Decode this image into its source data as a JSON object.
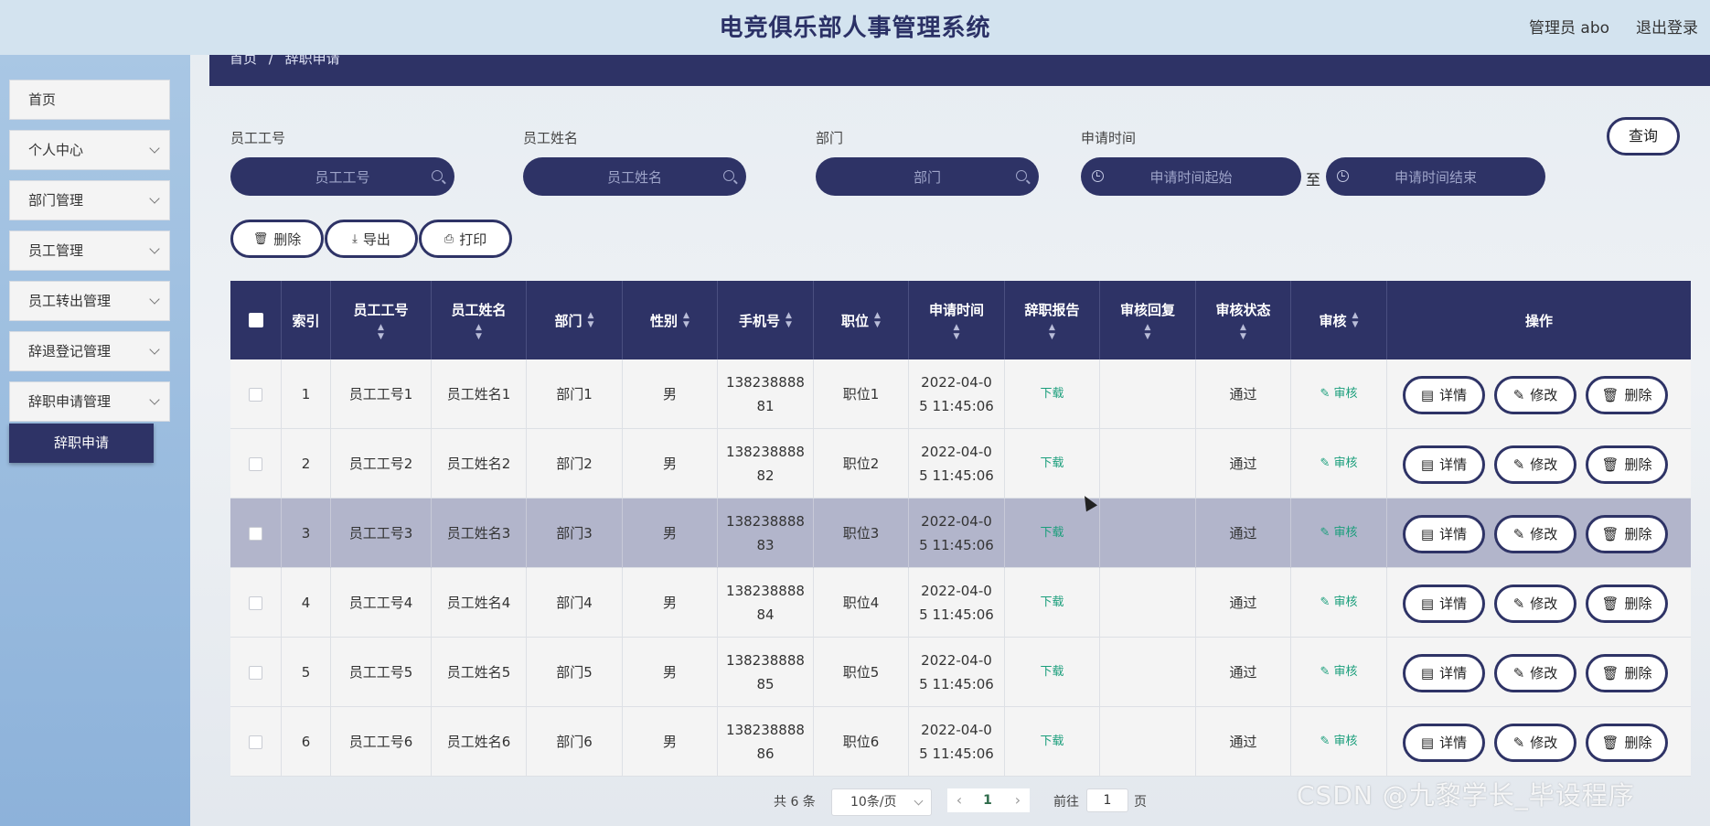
{
  "header": {
    "title": "电竞俱乐部人事管理系统",
    "admin": "管理员 abo",
    "logout": "退出登录"
  },
  "sidebar": {
    "items": [
      {
        "label": "首页",
        "expandable": false
      },
      {
        "label": "个人中心",
        "expandable": true
      },
      {
        "label": "部门管理",
        "expandable": true
      },
      {
        "label": "员工管理",
        "expandable": true
      },
      {
        "label": "员工转出管理",
        "expandable": true
      },
      {
        "label": "辞退登记管理",
        "expandable": true
      },
      {
        "label": "辞职申请管理",
        "expandable": true
      }
    ],
    "active_sub": "辞职申请"
  },
  "breadcrumb": {
    "home": "首页",
    "sep": "/",
    "current": "辞职申请"
  },
  "search": {
    "emp_no_label": "员工工号",
    "emp_no_placeholder": "员工工号",
    "emp_name_label": "员工姓名",
    "emp_name_placeholder": "员工姓名",
    "dept_label": "部门",
    "dept_placeholder": "部门",
    "time_label": "申请时间",
    "time_start_placeholder": "申请时间起始",
    "time_to": "至",
    "time_end_placeholder": "申请时间结束",
    "query_button": "查询"
  },
  "actions": {
    "delete": "删除",
    "export": "导出",
    "print": "打印"
  },
  "table": {
    "headers": {
      "index": "索引",
      "emp_no": "员工工号",
      "emp_name": "员工姓名",
      "dept": "部门",
      "gender": "性别",
      "phone": "手机号",
      "position": "职位",
      "apply_time": "申请时间",
      "report": "辞职报告",
      "reply": "审核回复",
      "status": "审核状态",
      "audit": "审核",
      "ops": "操作"
    },
    "rows": [
      {
        "index": "1",
        "emp_no": "员工工号1",
        "emp_name": "员工姓名1",
        "dept": "部门1",
        "gender": "男",
        "phone_a": "138238888",
        "phone_b": "81",
        "position": "职位1",
        "time_a": "2022-04-0",
        "time_b": "5 11:45:06",
        "report": "下载",
        "reply": "",
        "status": "通过",
        "audit": "审核"
      },
      {
        "index": "2",
        "emp_no": "员工工号2",
        "emp_name": "员工姓名2",
        "dept": "部门2",
        "gender": "男",
        "phone_a": "138238888",
        "phone_b": "82",
        "position": "职位2",
        "time_a": "2022-04-0",
        "time_b": "5 11:45:06",
        "report": "下载",
        "reply": "",
        "status": "通过",
        "audit": "审核"
      },
      {
        "index": "3",
        "emp_no": "员工工号3",
        "emp_name": "员工姓名3",
        "dept": "部门3",
        "gender": "男",
        "phone_a": "138238888",
        "phone_b": "83",
        "position": "职位3",
        "time_a": "2022-04-0",
        "time_b": "5 11:45:06",
        "report": "下载",
        "reply": "",
        "status": "通过",
        "audit": "审核"
      },
      {
        "index": "4",
        "emp_no": "员工工号4",
        "emp_name": "员工姓名4",
        "dept": "部门4",
        "gender": "男",
        "phone_a": "138238888",
        "phone_b": "84",
        "position": "职位4",
        "time_a": "2022-04-0",
        "time_b": "5 11:45:06",
        "report": "下载",
        "reply": "",
        "status": "通过",
        "audit": "审核"
      },
      {
        "index": "5",
        "emp_no": "员工工号5",
        "emp_name": "员工姓名5",
        "dept": "部门5",
        "gender": "男",
        "phone_a": "138238888",
        "phone_b": "85",
        "position": "职位5",
        "time_a": "2022-04-0",
        "time_b": "5 11:45:06",
        "report": "下载",
        "reply": "",
        "status": "通过",
        "audit": "审核"
      },
      {
        "index": "6",
        "emp_no": "员工工号6",
        "emp_name": "员工姓名6",
        "dept": "部门6",
        "gender": "男",
        "phone_a": "138238888",
        "phone_b": "86",
        "position": "职位6",
        "time_a": "2022-04-0",
        "time_b": "5 11:45:06",
        "report": "下载",
        "reply": "",
        "status": "通过",
        "audit": "审核"
      }
    ],
    "row_buttons": {
      "detail": "详情",
      "edit": "修改",
      "delete": "删除"
    },
    "highlighted_row": 3
  },
  "pagination": {
    "total": "共 6 条",
    "page_size": "10条/页",
    "current_page": "1",
    "goto_label": "前往",
    "goto_value": "1",
    "page_suffix": "页"
  },
  "watermark": "CSDN @九黎学长_毕设程序",
  "colors": {
    "primary": "#2e3366",
    "link_green": "#1a9e7b",
    "header_bg": "#d3e3ef",
    "sidebar_bg": "#a9c7e4"
  }
}
